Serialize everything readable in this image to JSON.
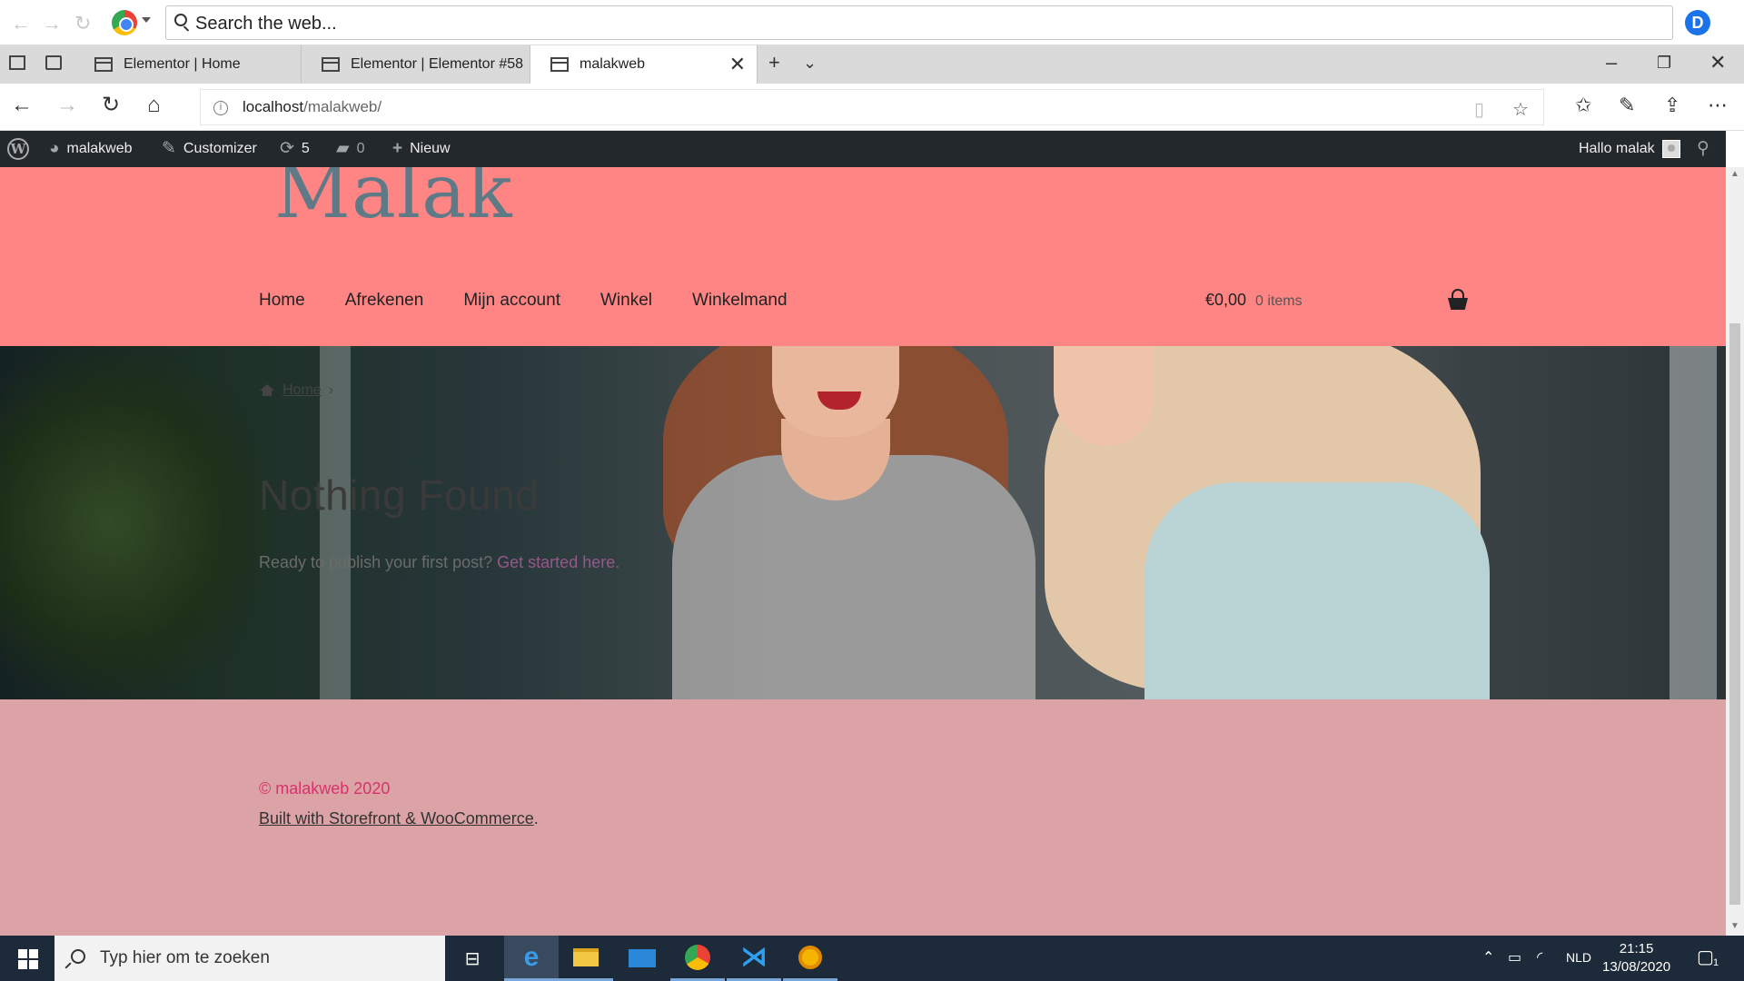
{
  "outer_browser": {
    "search_placeholder": "Search the web...",
    "profile_letter": "D"
  },
  "tabs": [
    {
      "label": "Elementor | Home"
    },
    {
      "label": "Elementor | Elementor #58"
    },
    {
      "label": "malakweb",
      "active": true
    }
  ],
  "address": {
    "host": "localhost",
    "path": "/malakweb/"
  },
  "wp_admin_bar": {
    "site_name": "malakweb",
    "customizer": "Customizer",
    "updates_count": "5",
    "comments_count": "0",
    "new_label": "Nieuw",
    "greeting": "Hallo malak"
  },
  "site": {
    "logo": "Malak",
    "nav": [
      "Home",
      "Afrekenen",
      "Mijn account",
      "Winkel",
      "Winkelmand"
    ],
    "cart_total": "€0,00",
    "cart_items": "0 items",
    "breadcrumb_home": "Home",
    "breadcrumb_sep": "›",
    "title": "Nothing Found",
    "message": "Ready to publish your first post?",
    "message_link": "Get started here",
    "message_end": ".",
    "footer_copyright": "© malakweb 2020",
    "footer_built": "Built with Storefront & WooCommerce",
    "footer_built_end": "."
  },
  "taskbar": {
    "search_placeholder": "Typ hier om te zoeken",
    "language": "NLD",
    "time": "21:15",
    "date": "13/08/2020",
    "notification_count": "1"
  },
  "colors": {
    "header_bg": "#ff8585",
    "footer_bg": "#dca3a6",
    "logo": "#5e7a86",
    "copyright": "#d6336c",
    "link": "#96588a",
    "wp_bar": "#23282d",
    "taskbar": "#1d2a3a"
  }
}
